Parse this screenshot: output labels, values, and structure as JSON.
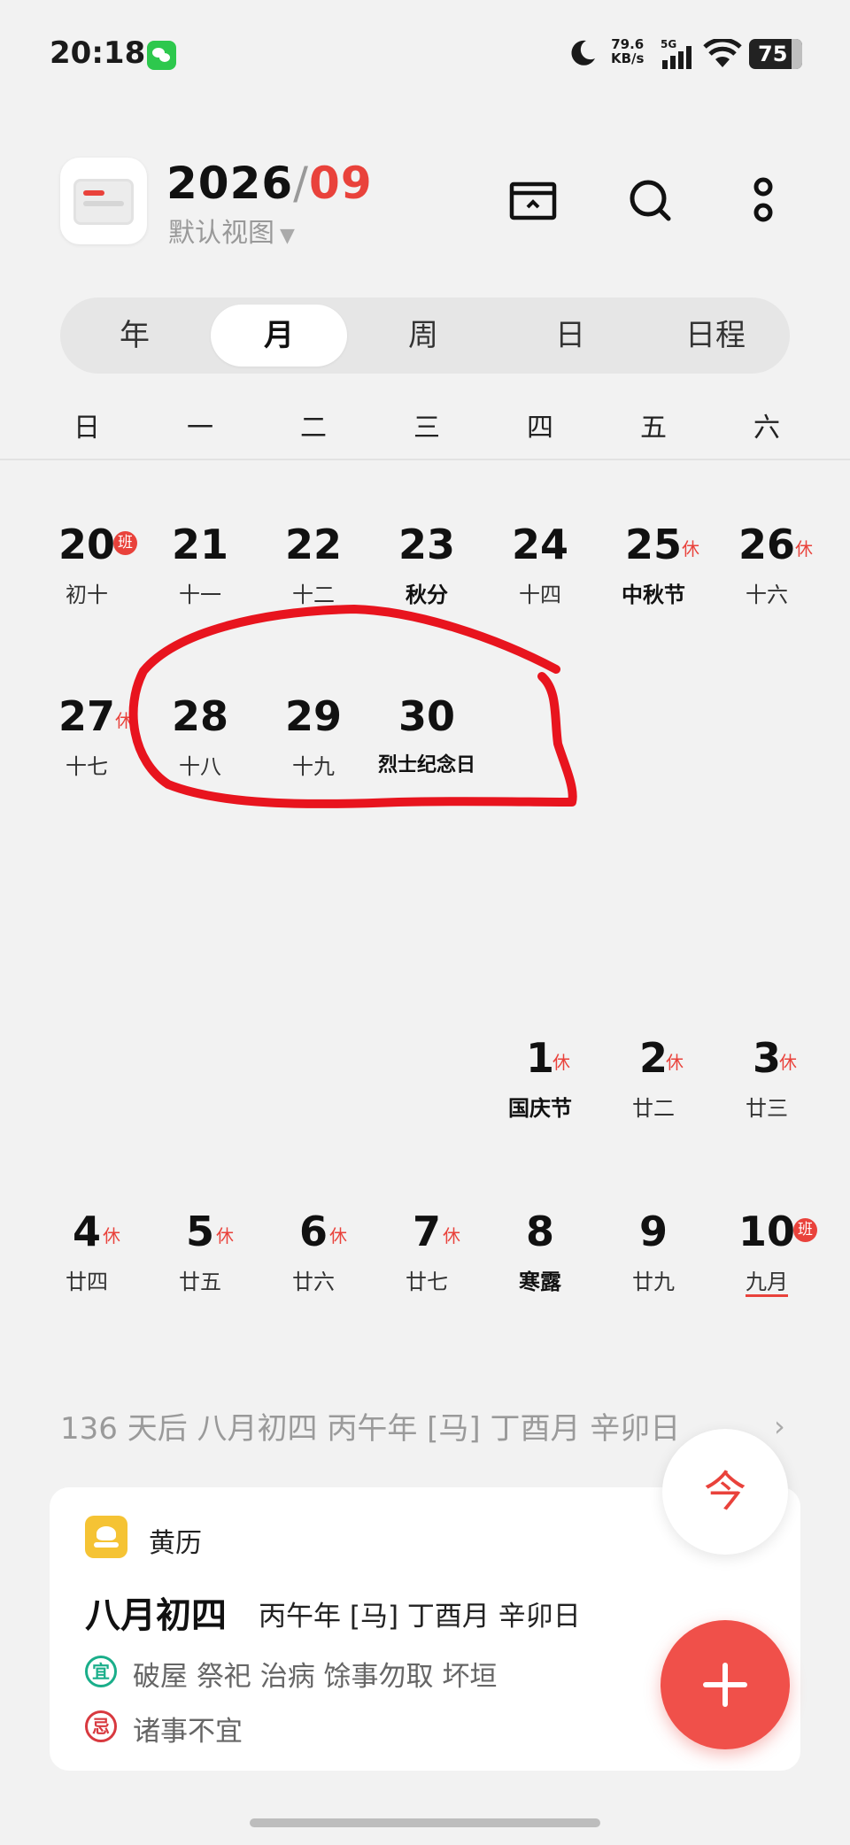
{
  "status_bar": {
    "time": "20:18",
    "net_speed_value": "79.6",
    "net_speed_unit": "KB/s",
    "network": "5G",
    "battery": "75",
    "icons": [
      "wechat-icon",
      "moon-icon",
      "signal-icon",
      "wifi-icon",
      "battery-icon"
    ]
  },
  "header": {
    "year": "2026",
    "separator": "/",
    "month": "09",
    "view_label": "默认视图",
    "view_caret": "▼",
    "accent_color": "#e9423b"
  },
  "tabs": [
    {
      "label": "年",
      "active": false
    },
    {
      "label": "月",
      "active": true
    },
    {
      "label": "周",
      "active": false
    },
    {
      "label": "日",
      "active": false
    },
    {
      "label": "日程",
      "active": false
    }
  ],
  "weekdays": [
    "日",
    "一",
    "二",
    "三",
    "四",
    "五",
    "六"
  ],
  "calendar": {
    "days": [
      {
        "day": "20",
        "lunar": "初十",
        "badge": "班"
      },
      {
        "day": "21",
        "lunar": "十一",
        "badge": ""
      },
      {
        "day": "22",
        "lunar": "十二",
        "badge": ""
      },
      {
        "day": "23",
        "lunar": "秋分",
        "badge": ""
      },
      {
        "day": "24",
        "lunar": "十四",
        "badge": ""
      },
      {
        "day": "25",
        "lunar": "中秋节",
        "badge": "休"
      },
      {
        "day": "26",
        "lunar": "十六",
        "badge": "休"
      },
      {
        "day": "27",
        "lunar": "十七",
        "badge": "休"
      },
      {
        "day": "28",
        "lunar": "十八",
        "badge": ""
      },
      {
        "day": "29",
        "lunar": "十九",
        "badge": ""
      },
      {
        "day": "30",
        "lunar": "烈士纪念日",
        "badge": ""
      },
      {
        "day": "1",
        "lunar": "国庆节",
        "badge": "休"
      },
      {
        "day": "2",
        "lunar": "廿二",
        "badge": "休"
      },
      {
        "day": "3",
        "lunar": "廿三",
        "badge": "休"
      },
      {
        "day": "4",
        "lunar": "廿四",
        "badge": "休"
      },
      {
        "day": "5",
        "lunar": "廿五",
        "badge": "休"
      },
      {
        "day": "6",
        "lunar": "廿六",
        "badge": "休"
      },
      {
        "day": "7",
        "lunar": "廿七",
        "badge": "休"
      },
      {
        "day": "8",
        "lunar": "寒露",
        "badge": ""
      },
      {
        "day": "9",
        "lunar": "廿九",
        "badge": ""
      },
      {
        "day": "10",
        "lunar": "九月",
        "badge": "班"
      }
    ]
  },
  "info_strip": {
    "text": "136 天后 八月初四 丙午年 [马] 丁酉月 辛卯日",
    "chevron": "›"
  },
  "almanac": {
    "name": "黄历",
    "lunar_date": "八月初四",
    "ganzhi": "丙午年 [马] 丁酉月 辛卯日",
    "yi_label": "宜",
    "yi_text": "破屋 祭祀 治病 馀事勿取 坏垣",
    "ji_label": "忌",
    "ji_text": "诸事不宜",
    "yi_color": "#1aae8a",
    "ji_color": "#d8393f"
  },
  "fab": {
    "today_label": "今",
    "add_icon": "plus-icon"
  }
}
